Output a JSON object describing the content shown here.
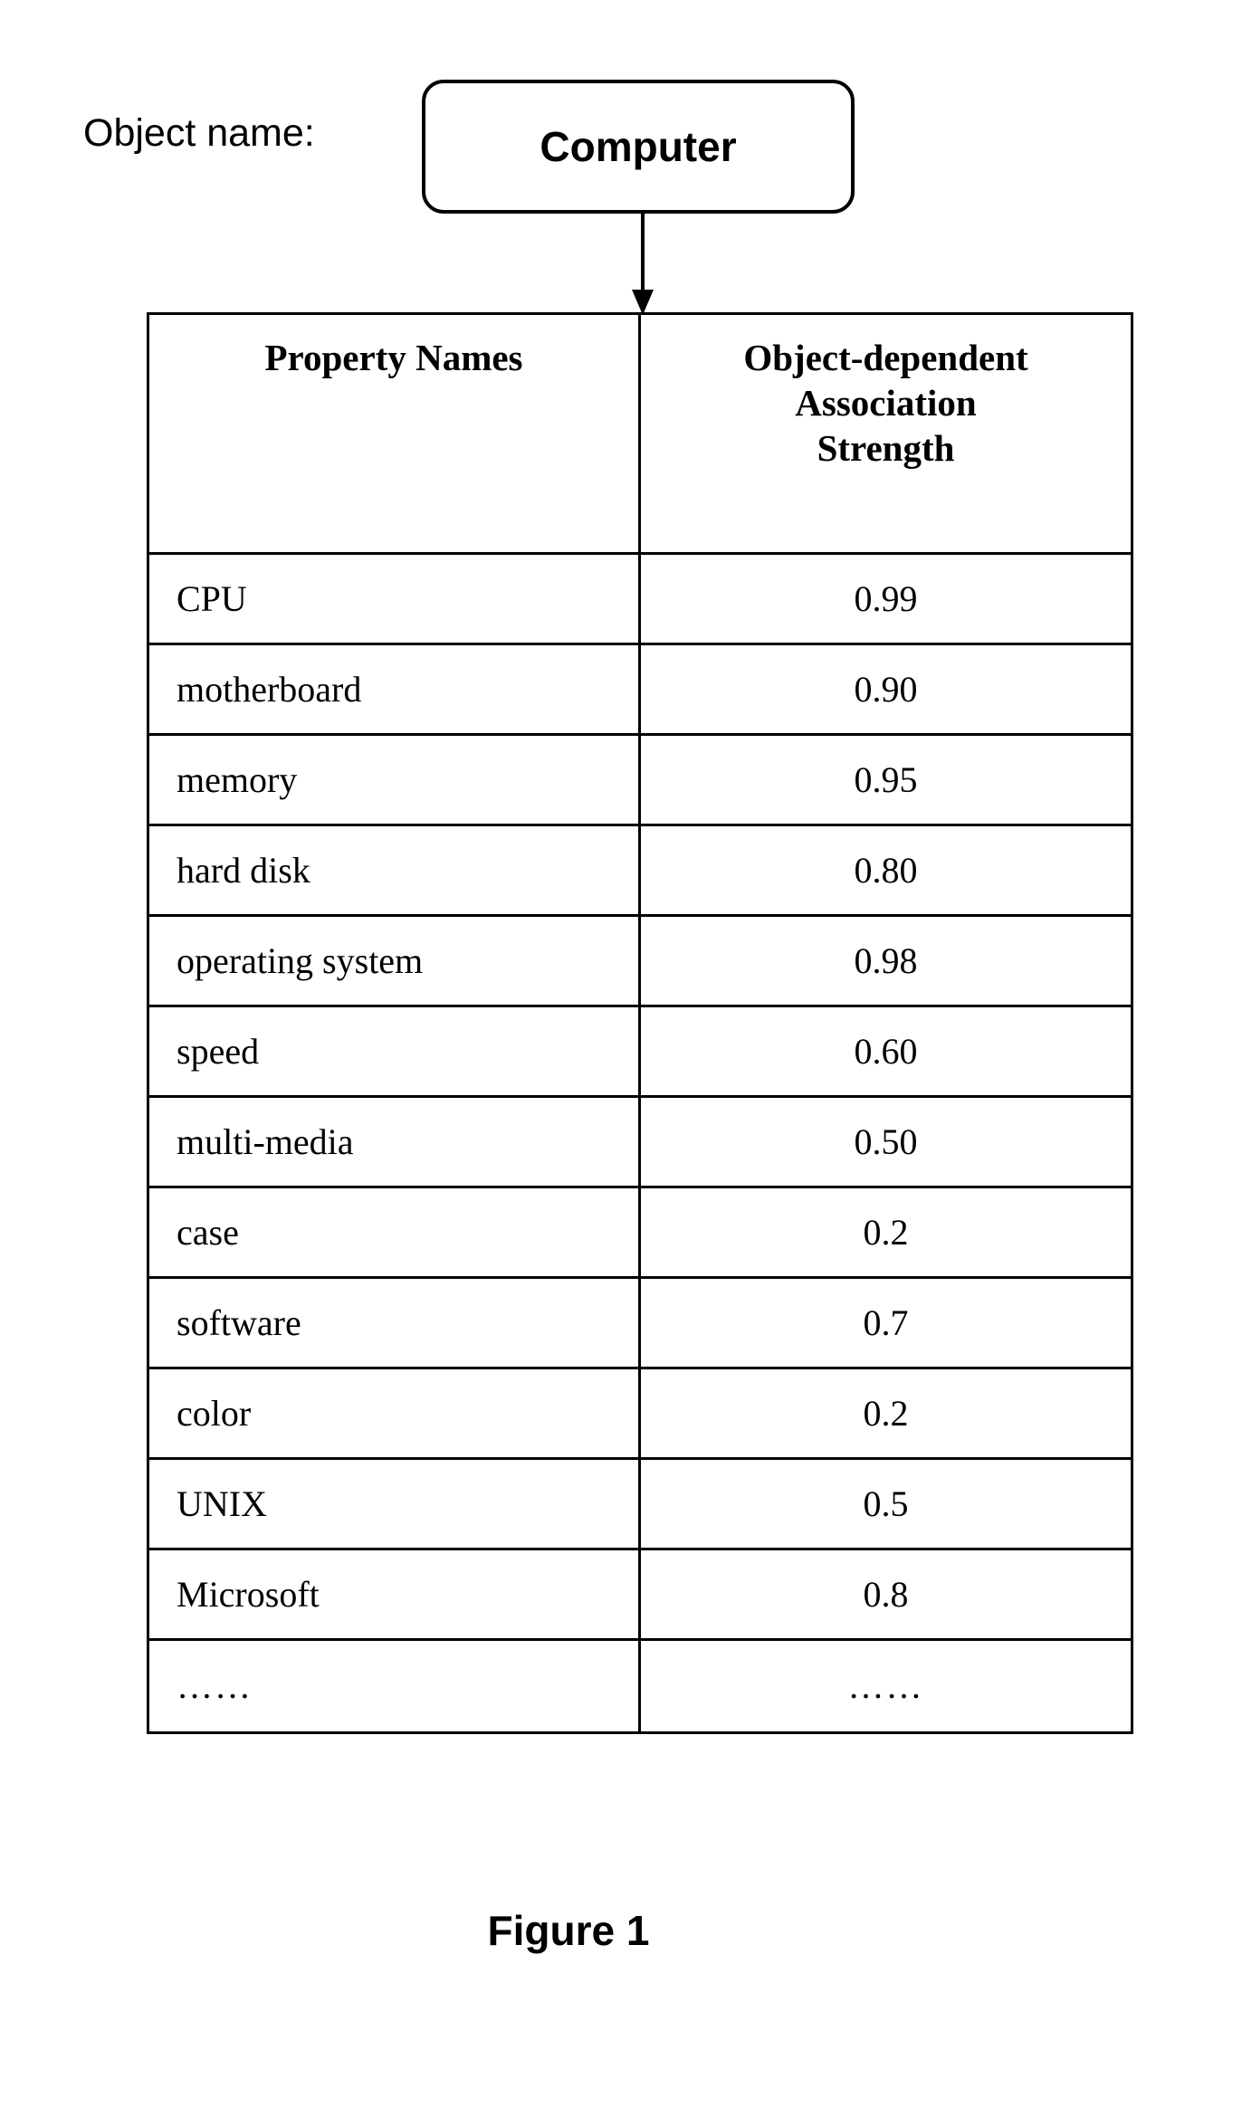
{
  "figure": {
    "caption": "Figure 1"
  },
  "object": {
    "label": "Object name:",
    "value": "Computer"
  },
  "table": {
    "headers": {
      "name": "Property Names",
      "value_line1": "Object-dependent",
      "value_line2": "Association",
      "value_line3": "Strength"
    },
    "rows": [
      {
        "name": "CPU",
        "value": "0.99"
      },
      {
        "name": "motherboard",
        "value": "0.90"
      },
      {
        "name": "memory",
        "value": "0.95"
      },
      {
        "name": "hard disk",
        "value": "0.80"
      },
      {
        "name": "operating system",
        "value": "0.98"
      },
      {
        "name": "speed",
        "value": "0.60"
      },
      {
        "name": "multi-media",
        "value": "0.50"
      },
      {
        "name": "case",
        "value": "0.2"
      },
      {
        "name": "software",
        "value": "0.7"
      },
      {
        "name": "color",
        "value": "0.2"
      },
      {
        "name": "UNIX",
        "value": "0.5"
      },
      {
        "name": "Microsoft",
        "value": "0.8"
      },
      {
        "name": "……",
        "value": "……"
      }
    ]
  },
  "colors": {
    "ink": "#000000",
    "paper": "#ffffff"
  }
}
